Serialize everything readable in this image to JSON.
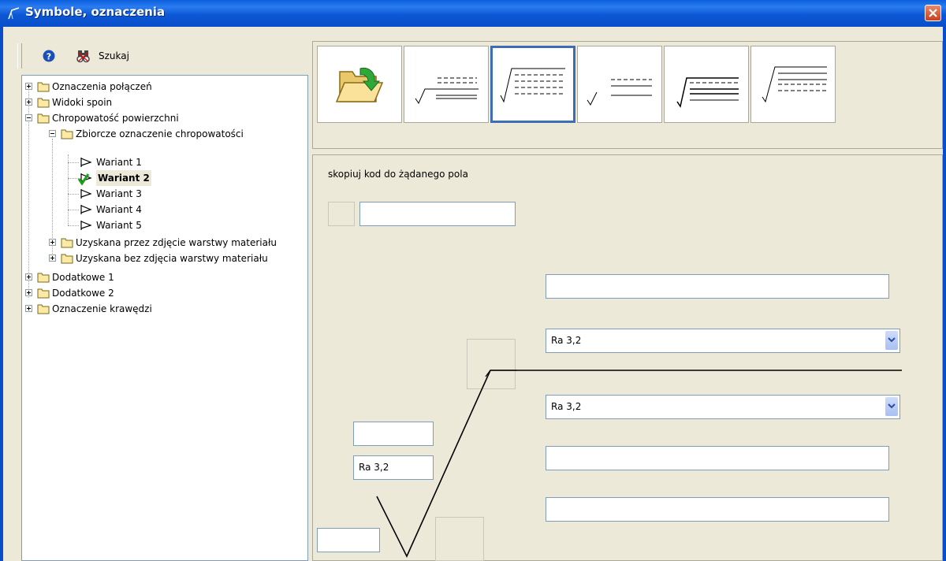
{
  "window": {
    "title": "Symbole, oznaczenia"
  },
  "toolbar": {
    "search_label": "Szukaj"
  },
  "tree": {
    "items": [
      "Oznaczenia połączeń",
      "Widoki spoin",
      "Chropowatość powierzchni",
      "Zbiorcze oznaczenie chropowatości",
      "Wariant 1",
      "Wariant 2",
      "Wariant 3",
      "Wariant 4",
      "Wariant 5",
      "Uzyskana przez zdjęcie warstwy materiału",
      "Uzyskana bez zdjęcia warstwy materiału",
      "Dodatkowe 1",
      "Dodatkowe 2",
      "Oznaczenie krawędzi"
    ],
    "selected": "Wariant 2"
  },
  "editor": {
    "hint": "skopiuj kod do żądanego pola",
    "code_value": "",
    "field_top": "",
    "upper_select": "Ra 3,2",
    "lower_select": "Ra 3,2",
    "field_mid": "",
    "field_bottom": "",
    "left_field_top": "",
    "left_field_value": "Ra 3,2",
    "left_field_corner": ""
  },
  "colors": {
    "titlebar": "#0a5fdc",
    "selected_border": "#3d6db5",
    "window_bg": "#ece9d8"
  }
}
